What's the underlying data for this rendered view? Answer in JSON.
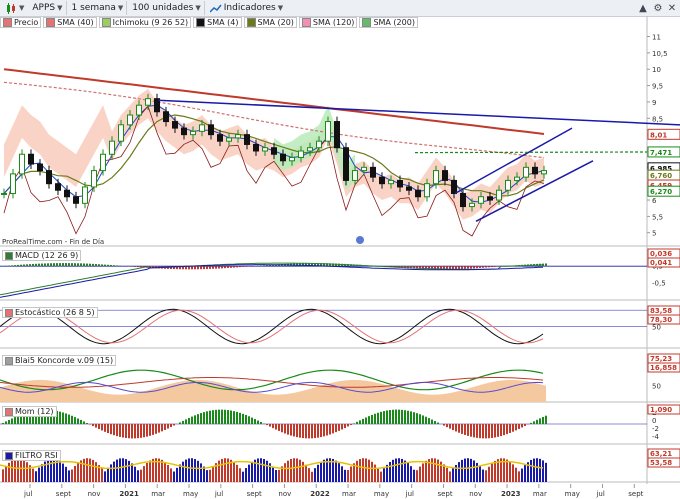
{
  "toolbar": {
    "symbol": "APPS",
    "period": "1 semana",
    "units": "100 unidades",
    "indicators": "Indicadores"
  },
  "colors": {
    "bull": "#1a8a1a",
    "bear": "#111111",
    "sma40": "#c0392b",
    "sma20": "#6b7a1a",
    "sma120": "#d07070",
    "sma200": "#c0392b",
    "trendline": "#1a1aa8",
    "cloud_bull": "#b8eab8",
    "cloud_bear": "#f7c9b8"
  },
  "legend": [
    {
      "label": "Precio",
      "color": "#e57373"
    },
    {
      "label": "SMA (40)",
      "color": "#e57373"
    },
    {
      "label": "Ichimoku (9 26 52)",
      "color": "#9ccc65"
    },
    {
      "label": "SMA (4)",
      "color": "#111111"
    },
    {
      "label": "SMA (20)",
      "color": "#6b7a1a"
    },
    {
      "label": "SMA (120)",
      "color": "#f48fb1"
    },
    {
      "label": "SMA (200)",
      "color": "#66bb6a"
    }
  ],
  "price_axis": [
    "11",
    "10,5",
    "10",
    "9,5",
    "9",
    "8,5",
    "8",
    "7,5",
    "7",
    "6,5",
    "6",
    "5,5",
    "5"
  ],
  "price_badges": [
    {
      "text": "8,01",
      "color": "#c0392b",
      "value": 8.01
    },
    {
      "text": "7,471",
      "color": "#1a8a1a",
      "value": 7.471
    },
    {
      "text": "6,985",
      "color": "#111111",
      "value": 6.985
    },
    {
      "text": "6,760",
      "color": "#6b7a1a",
      "value": 6.76
    },
    {
      "text": "6,459",
      "color": "#c0392b",
      "value": 6.459
    },
    {
      "text": "6,270",
      "color": "#1a8a1a",
      "value": 6.27
    }
  ],
  "source": "ProRealTime.com - Fin de Día",
  "panels": {
    "macd": {
      "label": "MACD (12 26 9)",
      "axis": [
        "0,5",
        "-0,5"
      ],
      "badges": [
        "0,036",
        "0,041"
      ]
    },
    "stoch": {
      "label": "Estocástico (26 8 5)",
      "axis": [
        "50"
      ],
      "badges": [
        "83,58",
        "78,30"
      ]
    },
    "koncorde": {
      "label": "Blai5 Koncorde v.09 (15)",
      "axis": [
        "100",
        "50"
      ],
      "badges": [
        "75,23",
        "16,858"
      ]
    },
    "mom": {
      "label": "Mom (12)",
      "axis": [
        "2",
        "0",
        "-2",
        "-4"
      ],
      "badges": [
        "1,090"
      ]
    },
    "rsi": {
      "label": "FILTRO RSI",
      "axis": [],
      "badges": [
        "63,21",
        "53,58"
      ]
    }
  },
  "time_axis": [
    {
      "label": "jul",
      "bold": false
    },
    {
      "label": "sept",
      "bold": false
    },
    {
      "label": "nov",
      "bold": false
    },
    {
      "label": "2021",
      "bold": true
    },
    {
      "label": "mar",
      "bold": false
    },
    {
      "label": "may",
      "bold": false
    },
    {
      "label": "jul",
      "bold": false
    },
    {
      "label": "sept",
      "bold": false
    },
    {
      "label": "nov",
      "bold": false
    },
    {
      "label": "2022",
      "bold": true
    },
    {
      "label": "mar",
      "bold": false
    },
    {
      "label": "may",
      "bold": false
    },
    {
      "label": "jul",
      "bold": false
    },
    {
      "label": "sept",
      "bold": false
    },
    {
      "label": "nov",
      "bold": false
    },
    {
      "label": "2023",
      "bold": true
    },
    {
      "label": "mar",
      "bold": false
    },
    {
      "label": "may",
      "bold": false
    },
    {
      "label": "jul",
      "bold": false
    },
    {
      "label": "sept",
      "bold": false
    }
  ],
  "price_series": [
    6.2,
    6.8,
    7.4,
    7.1,
    6.9,
    6.5,
    6.3,
    6.1,
    5.9,
    6.4,
    6.9,
    7.4,
    7.8,
    8.3,
    8.6,
    8.9,
    9.1,
    8.7,
    8.4,
    8.2,
    8.0,
    8.1,
    8.3,
    8.0,
    7.8,
    7.9,
    8.0,
    7.7,
    7.5,
    7.6,
    7.4,
    7.2,
    7.3,
    7.5,
    7.6,
    7.8,
    8.4,
    7.6,
    6.6,
    6.9,
    7.0,
    6.7,
    6.5,
    6.6,
    6.4,
    6.3,
    6.1,
    6.5,
    6.9,
    6.6,
    6.2,
    5.8,
    5.9,
    6.1,
    6.0,
    6.3,
    6.6,
    6.7,
    7.0,
    6.8,
    6.9
  ]
}
